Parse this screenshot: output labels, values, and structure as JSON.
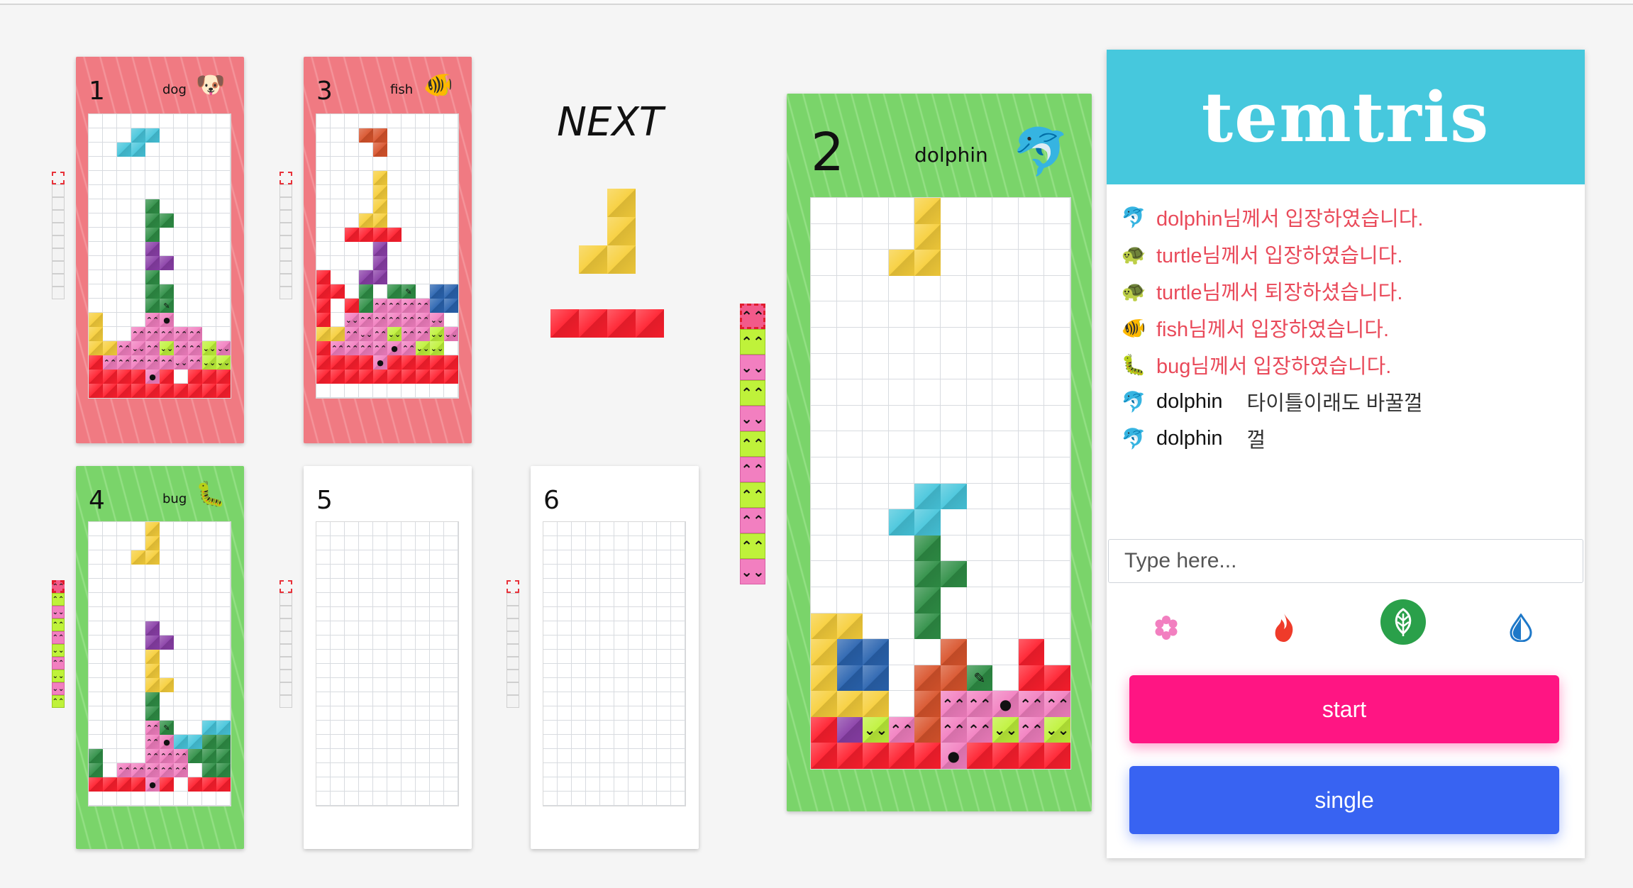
{
  "colors": {
    "accent_header": "#46c8dd",
    "start": "#ff1583",
    "single": "#3863f2",
    "system_msg": "#e94a5a"
  },
  "next": {
    "title": "NEXT",
    "pieces": [
      {
        "shape": "J",
        "color": "#f7cf3b"
      },
      {
        "shape": "I",
        "color": "#ff1f2e"
      }
    ]
  },
  "boards": [
    {
      "id": "1",
      "number": "1",
      "name": "dog",
      "avatar": "🐶",
      "theme": "red",
      "mode": "mini",
      "attack_queue": []
    },
    {
      "id": "3",
      "number": "3",
      "name": "fish",
      "avatar": "🐠",
      "theme": "red",
      "mode": "mini",
      "attack_queue": []
    },
    {
      "id": "4",
      "number": "4",
      "name": "bug",
      "avatar": "🐛",
      "theme": "green",
      "mode": "mini",
      "attack_queue": [
        "up",
        "down",
        "up",
        "up",
        "down",
        "up",
        "down",
        "down",
        "up"
      ]
    },
    {
      "id": "5",
      "number": "5",
      "name": "",
      "avatar": "",
      "theme": "empty",
      "mode": "mini",
      "attack_queue": []
    },
    {
      "id": "6",
      "number": "6",
      "name": "",
      "avatar": "",
      "theme": "empty",
      "mode": "mini",
      "attack_queue": []
    },
    {
      "id": "2",
      "number": "2",
      "name": "dolphin",
      "avatar": "🐬",
      "theme": "green",
      "mode": "main",
      "attack_queue": [
        "up",
        "down",
        "up",
        "down",
        "up",
        "up",
        "up",
        "up",
        "up",
        "down"
      ]
    }
  ],
  "panel": {
    "title": "temtris",
    "messages": [
      {
        "icon": "🐬",
        "type": "system",
        "text": "dolphin님께서 입장하였습니다."
      },
      {
        "icon": "🐢",
        "type": "system",
        "text": "turtle님께서 입장하였습니다."
      },
      {
        "icon": "🐢",
        "type": "system",
        "text": "turtle님께서 퇴장하셨습니다."
      },
      {
        "icon": "🐠",
        "type": "system",
        "text": "fish님께서 입장하였습니다."
      },
      {
        "icon": "🐛",
        "type": "system",
        "text": "bug님께서 입장하였습니다."
      },
      {
        "icon": "🐬",
        "type": "user",
        "user": "dolphin",
        "text": "타이틀이래도 바꿀껄"
      },
      {
        "icon": "🐬",
        "type": "user",
        "user": "dolphin",
        "text": "껄"
      }
    ],
    "input_placeholder": "Type here...",
    "themes": [
      {
        "name": "flower",
        "icon": "flower-icon",
        "color": "#f27fc0",
        "selected": false
      },
      {
        "name": "fire",
        "icon": "fire-icon",
        "color": "#ef3b2a",
        "selected": false
      },
      {
        "name": "leaf",
        "icon": "leaf-icon",
        "color": "#ffffff",
        "selected": true
      },
      {
        "name": "water",
        "icon": "water-drop-icon",
        "color": "#1e78c8",
        "selected": false
      }
    ],
    "start_label": "start",
    "single_label": "single"
  }
}
